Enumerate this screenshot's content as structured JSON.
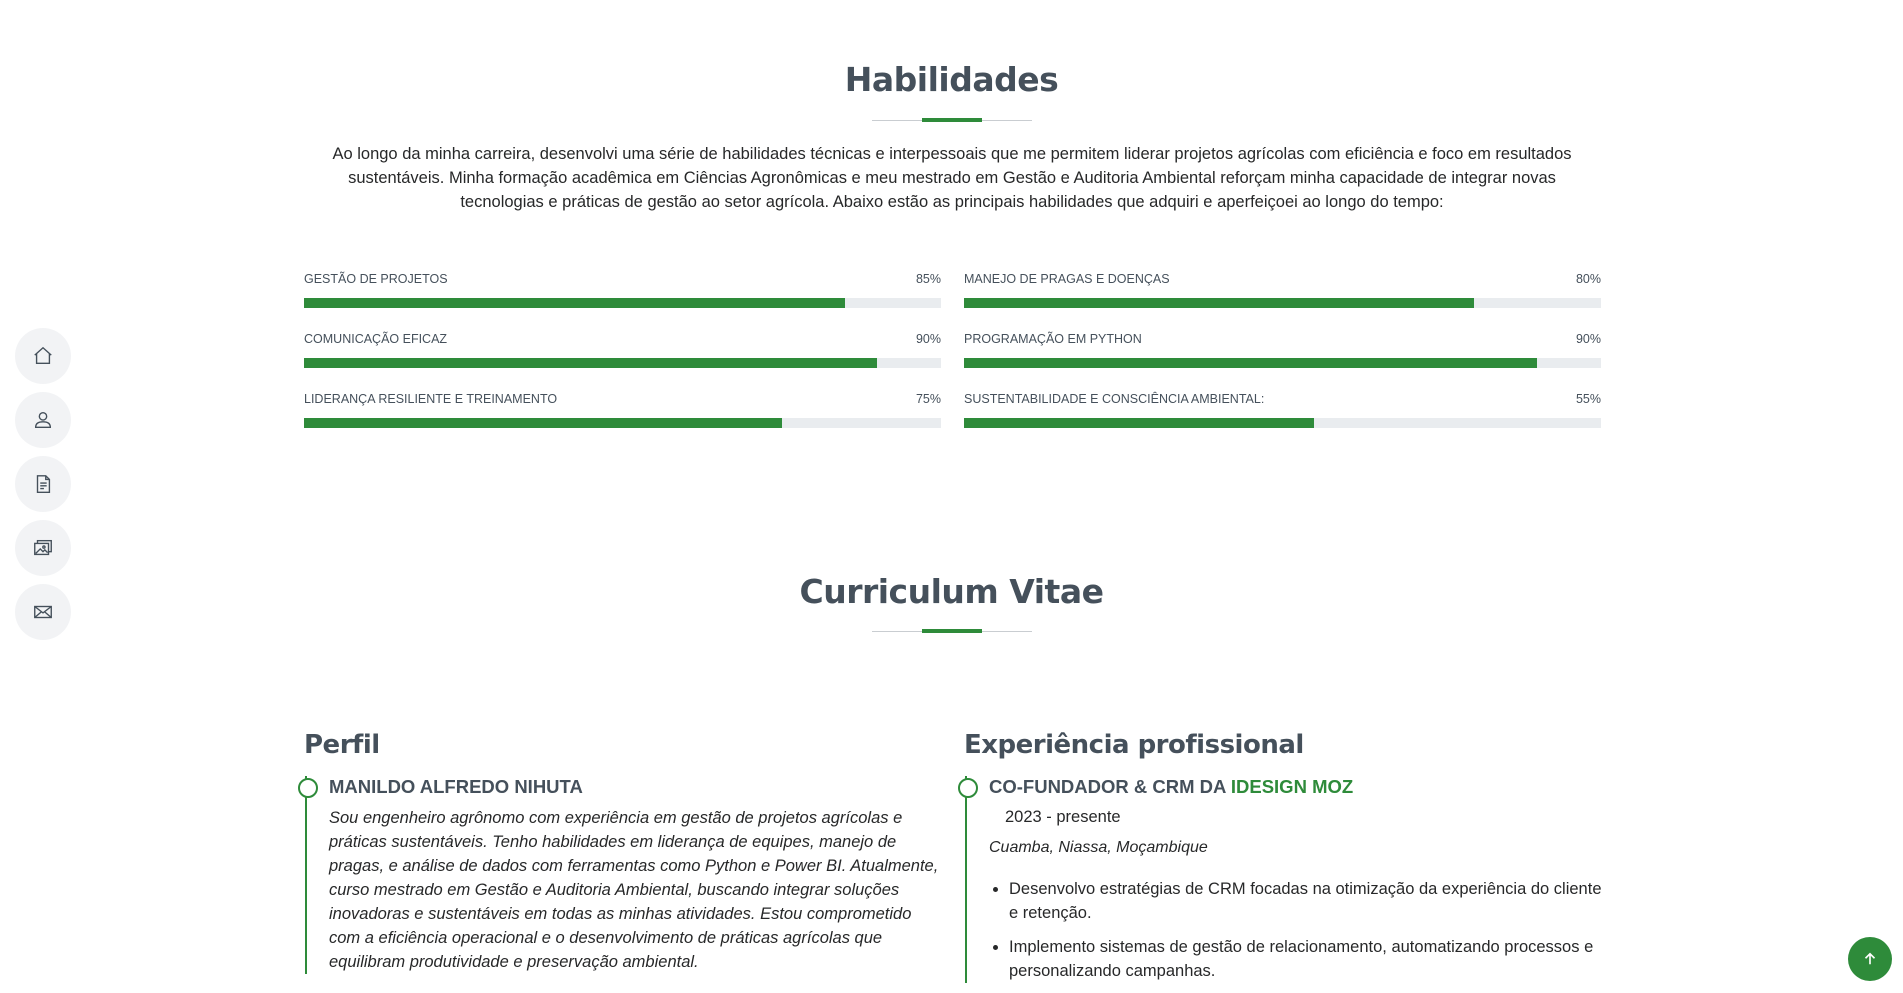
{
  "nav": {
    "items": [
      {
        "icon": "home-icon",
        "label": "Home"
      },
      {
        "icon": "person-icon",
        "label": "About"
      },
      {
        "icon": "file-text-icon",
        "label": "Resume"
      },
      {
        "icon": "images-icon",
        "label": "Portfolio"
      },
      {
        "icon": "envelope-icon",
        "label": "Contact"
      }
    ]
  },
  "skills": {
    "title": "Habilidades",
    "description": "Ao longo da minha carreira, desenvolvi uma série de habilidades técnicas e interpessoais que me permitem liderar projetos agrícolas com eficiência e foco em resultados sustentáveis. Minha formação acadêmica em Ciências Agronômicas e meu mestrado em Gestão e Auditoria Ambiental reforçam minha capacidade de integrar novas tecnologias e práticas de gestão ao setor agrícola. Abaixo estão as principais habilidades que adquiri e aperfeiçoei ao longo do tempo:",
    "left": [
      {
        "name": "GESTÃO DE PROJETOS",
        "percent_label": "85%",
        "value": 85
      },
      {
        "name": "COMUNICAÇÃO EFICAZ",
        "percent_label": "90%",
        "value": 90
      },
      {
        "name": "LIDERANÇA RESILIENTE E TREINAMENTO",
        "percent_label": "75%",
        "value": 75
      }
    ],
    "right": [
      {
        "name": "MANEJO DE PRAGAS E DOENÇAS",
        "percent_label": "80%",
        "value": 80
      },
      {
        "name": "PROGRAMAÇÃO EM PYTHON",
        "percent_label": "90%",
        "value": 90
      },
      {
        "name": "SUSTENTABILIDADE E CONSCIÊNCIA AMBIENTAL:",
        "percent_label": "55%",
        "value": 55
      }
    ]
  },
  "cv": {
    "title": "Curriculum Vitae",
    "profile": {
      "heading": "Perfil",
      "name": "MANILDO ALFREDO NIHUTA",
      "text": "Sou engenheiro agrônomo com experiência em gestão de projetos agrícolas e práticas sustentáveis. Tenho habilidades em liderança de equipes, manejo de pragas, e análise de dados com ferramentas como Python e Power BI. Atualmente, curso mestrado em Gestão e Auditoria Ambiental, buscando integrar soluções inovadoras e sustentáveis em todas as minhas atividades. Estou comprometido com a eficiência operacional e o desenvolvimento de práticas agrícolas que equilibram produtividade e preservação ambiental."
    },
    "experience": {
      "heading": "Experiência profissional",
      "role": "CO-FUNDADOR & CRM DA",
      "company": "IDESIGN MOZ",
      "period": "2023 - presente",
      "location": "Cuamba, Niassa, Moçambique",
      "bullets": [
        "Desenvolvo estratégias de CRM focadas na otimização da experiência do cliente e retenção.",
        "Implemento sistemas de gestão de relacionamento, automatizando processos e personalizando campanhas."
      ]
    }
  },
  "colors": {
    "accent": "#2e8b3a",
    "heading": "#45505b",
    "track": "#e9ecef"
  }
}
